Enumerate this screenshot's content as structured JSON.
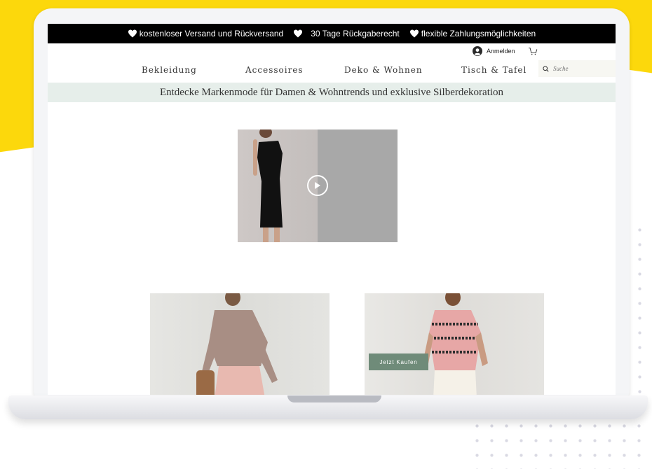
{
  "promo": {
    "items": [
      "kostenloser Versand und Rückversand",
      "30 Tage Rückgaberecht",
      "flexible Zahlungsmöglichkeiten"
    ]
  },
  "header": {
    "login_label": "Anmelden",
    "search_placeholder": "Suche"
  },
  "nav": {
    "items": [
      "Bekleidung",
      "Accessoires",
      "Deko & Wohnen",
      "Tisch & Tafel"
    ]
  },
  "tagline": "Entdecke Markenmode für Damen & Wohntrends und exklusive Silberdekoration",
  "product_grid": {
    "buy_label": "Jetzt Kaufen"
  },
  "colors": {
    "accent_yellow": "#fcd80c",
    "promo_bg": "#000000",
    "tagline_bg": "#e6eeea",
    "buy_button": "#6f8b79"
  },
  "icons": {
    "promo": "heart-icon",
    "login": "user-avatar-icon",
    "cart": "shopping-cart-icon",
    "search": "search-icon",
    "video": "play-icon"
  }
}
